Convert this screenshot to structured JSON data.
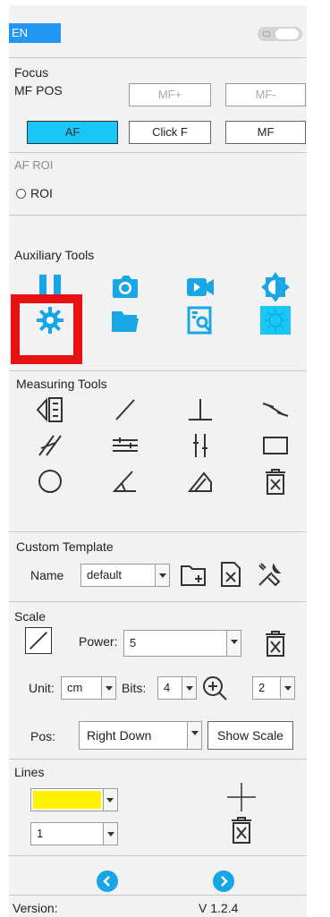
{
  "header": {
    "language": "EN"
  },
  "focus": {
    "title": "Focus",
    "mf_pos_label": "MF POS",
    "mf_plus": "MF+",
    "mf_minus": "MF-",
    "af": "AF",
    "click_f": "Click F",
    "mf": "MF"
  },
  "af_roi": {
    "title": "AF ROI",
    "roi_label": "ROI"
  },
  "auxiliary": {
    "title": "Auxiliary Tools"
  },
  "measuring": {
    "title": "Measuring Tools"
  },
  "template": {
    "title": "Custom Template",
    "name_label": "Name",
    "name_value": "default"
  },
  "scale": {
    "title": "Scale",
    "power_label": "Power:",
    "power_value": "5",
    "unit_label": "Unit:",
    "unit_value": "cm",
    "bits_label": "Bits:",
    "bits_value": "4",
    "zoom_value": "2",
    "pos_label": "Pos:",
    "pos_value": "Right Down",
    "show_scale": "Show Scale"
  },
  "lines": {
    "title": "Lines",
    "color_value": "#fff200",
    "width_value": "1"
  },
  "footer": {
    "version_label": "Version:",
    "version_value": "V 1.2.4"
  },
  "colors": {
    "accent": "#19a6e6",
    "selected": "#19c7f6",
    "highlight_box": "#e81010"
  }
}
